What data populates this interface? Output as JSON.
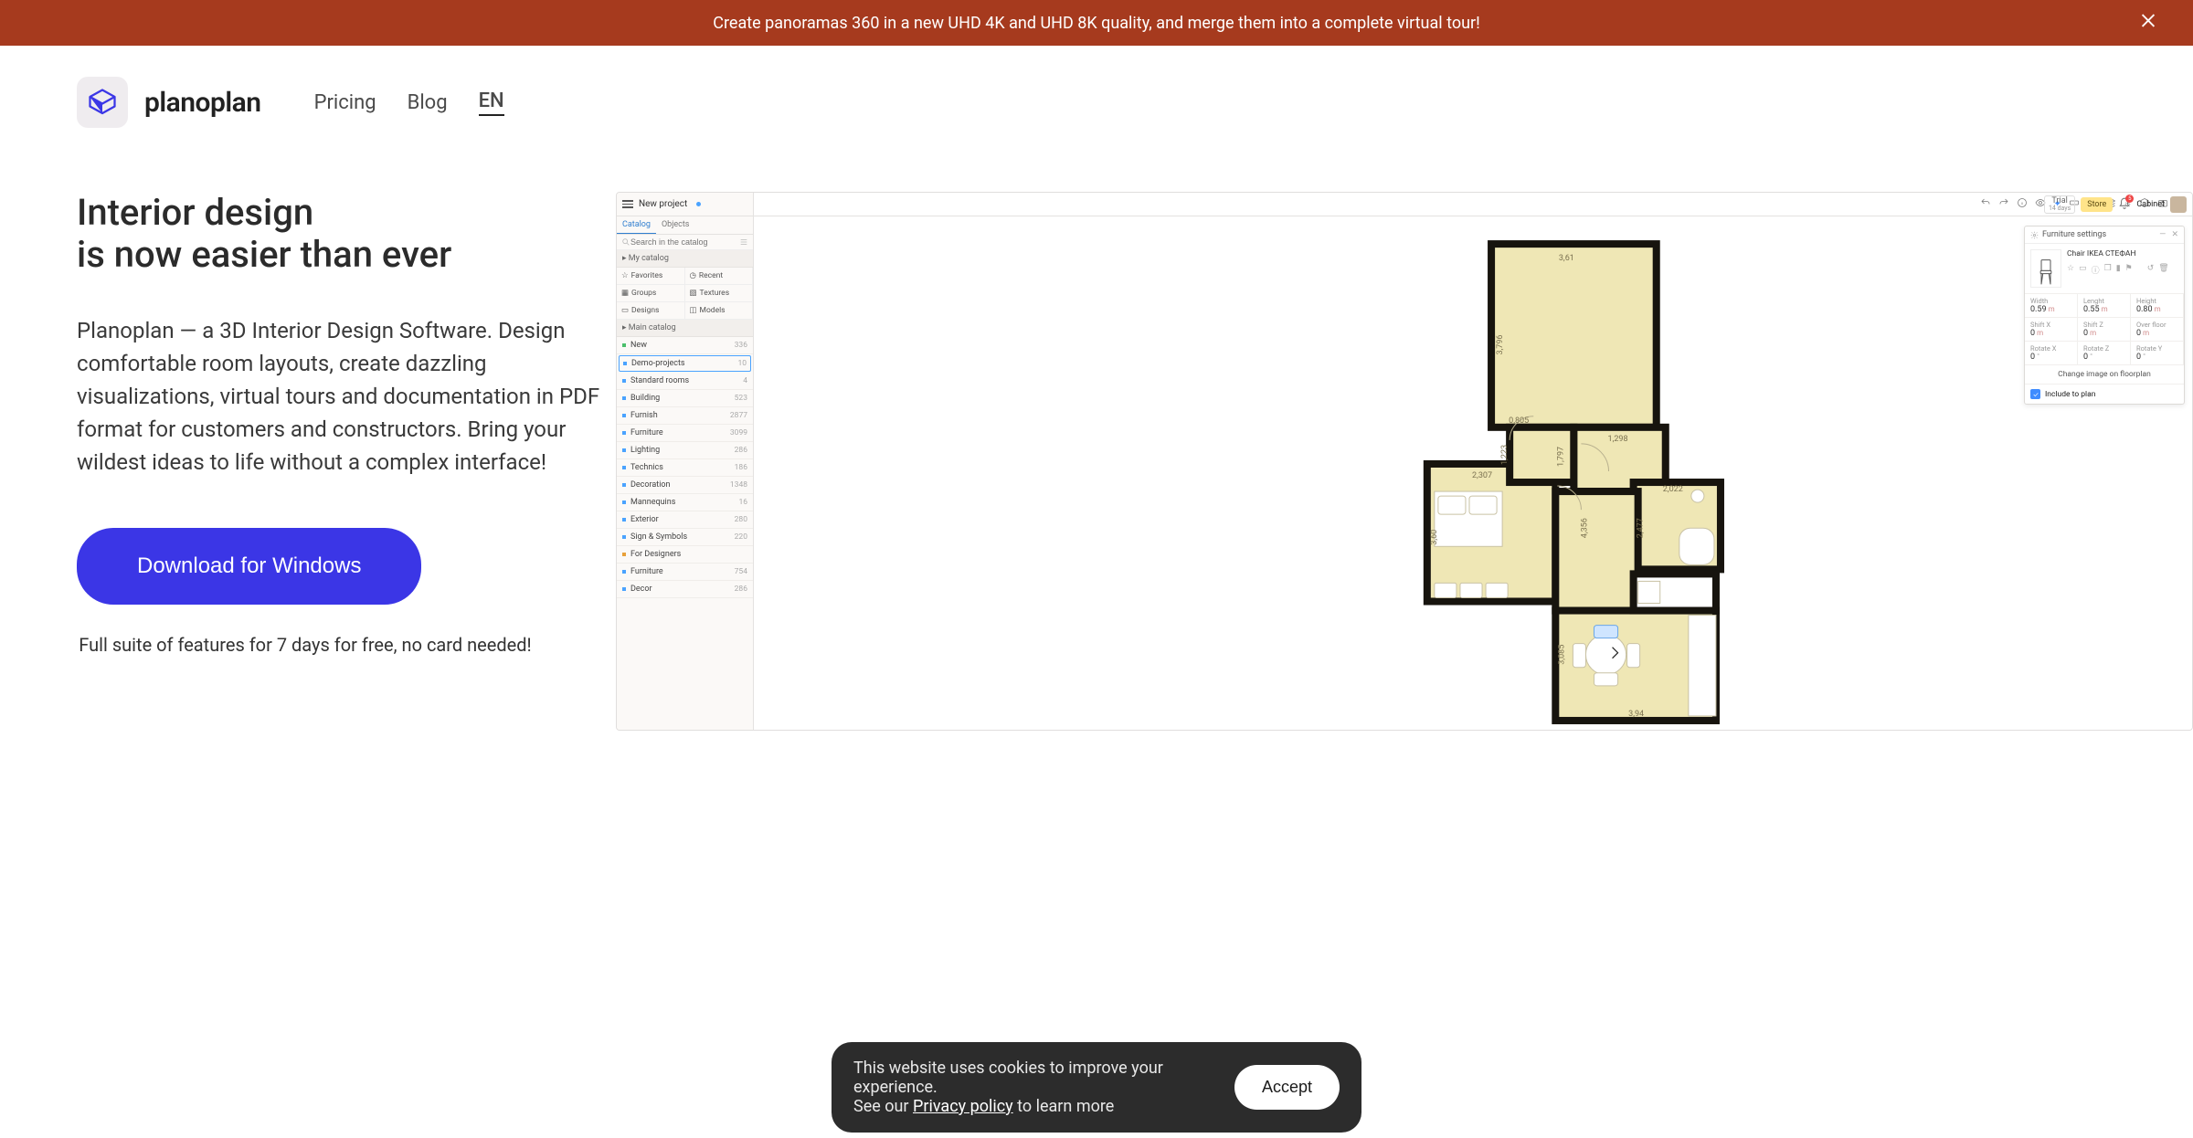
{
  "announce": {
    "text": "Create panoramas 360 in a new UHD 4K and UHD 8K quality, and merge them into a complete virtual tour!"
  },
  "header": {
    "brand": "planoplan",
    "nav_pricing": "Pricing",
    "nav_blog": "Blog",
    "lang": "EN"
  },
  "hero": {
    "title_l1": "Interior design",
    "title_l2": "is now easier than ever",
    "lead": "Planoplan — a 3D Interior Design Software. Design comfortable room layouts, create dazzling visualizations, virtual tours and documentation in PDF format for customers and constructors. Bring your wildest ideas to life without a complex interface!",
    "cta": "Download for Windows",
    "trial_note": "Full suite of features for 7 days for free, no card needed!"
  },
  "app": {
    "project_name": "New project",
    "tabs": {
      "catalog": "Catalog",
      "objects": "Objects"
    },
    "search_placeholder": "Search in the catalog",
    "my_catalog_label": "My catalog",
    "quick": {
      "favorites": "Favorites",
      "recent": "Recent",
      "groups": "Groups",
      "textures": "Textures",
      "designs": "Designs",
      "models": "Models"
    },
    "main_catalog_label": "Main catalog",
    "categories": [
      {
        "name": "New",
        "count": "336",
        "color": "green"
      },
      {
        "name": "Demo-projects",
        "count": "10",
        "color": "blue",
        "hl": true
      },
      {
        "name": "Standard rooms",
        "count": "4",
        "color": "blue"
      },
      {
        "name": "Building",
        "count": "523",
        "color": "blue"
      },
      {
        "name": "Furnish",
        "count": "2877",
        "color": "blue"
      },
      {
        "name": "Furniture",
        "count": "3099",
        "color": "blue"
      },
      {
        "name": "Lighting",
        "count": "286",
        "color": "blue"
      },
      {
        "name": "Technics",
        "count": "186",
        "color": "blue"
      },
      {
        "name": "Decoration",
        "count": "1348",
        "color": "blue"
      },
      {
        "name": "Mannequins",
        "count": "16",
        "color": "blue"
      },
      {
        "name": "Exterior",
        "count": "280",
        "color": "blue"
      },
      {
        "name": "Sign & Symbols",
        "count": "220",
        "color": "blue"
      },
      {
        "name": "For Designers",
        "count": "",
        "color": "orange"
      },
      {
        "name": "Furniture",
        "count": "754",
        "color": "blue"
      },
      {
        "name": "Decor",
        "count": "286",
        "color": "blue"
      }
    ],
    "account": {
      "trial_label": "Trial",
      "trial_days": "14 days",
      "store": "Store",
      "cabinet": "Cabinet",
      "bell_badge": "5"
    },
    "props": {
      "panel_title": "Furniture settings",
      "item_name": "Chair IKEA СТЕФАН",
      "fields": {
        "width": {
          "label": "Width",
          "value": "0.59",
          "unit": "m"
        },
        "length": {
          "label": "Lenght",
          "value": "0.55",
          "unit": "m"
        },
        "height": {
          "label": "Height",
          "value": "0.80",
          "unit": "m"
        },
        "shiftx": {
          "label": "Shift X",
          "value": "0",
          "unit": "m"
        },
        "shiftz": {
          "label": "Shift Z",
          "value": "0",
          "unit": "m"
        },
        "overfl": {
          "label": "Over floor",
          "value": "0",
          "unit": "m"
        },
        "rotx": {
          "label": "Rotate X",
          "value": "0",
          "unit": "°"
        },
        "rotz": {
          "label": "Rotate Z",
          "value": "0",
          "unit": "°"
        },
        "roty": {
          "label": "Rotate Y",
          "value": "0",
          "unit": "°"
        }
      },
      "change_image": "Change image on floorplan",
      "include": "Include to plan"
    },
    "dims": {
      "d1": "3,61",
      "d2": "3,796",
      "d3": "0,805",
      "d4": "1,223",
      "d5": "1,797",
      "d6": "1,298",
      "d7": "2,307",
      "d8": "4,356",
      "d9": "2,022",
      "d10": "3,60",
      "d11": "2,477",
      "d12": "3,085",
      "d13": "3,94"
    }
  },
  "cookie": {
    "line1": "This website uses cookies to improve your experience.",
    "see_our": "See our ",
    "policy": "Privacy policy",
    "learn_more": " to learn more",
    "accept": "Accept"
  }
}
